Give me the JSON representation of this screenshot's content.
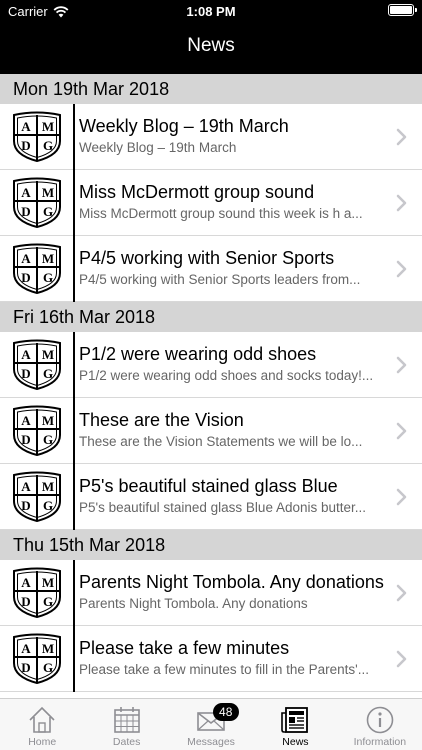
{
  "status": {
    "carrier": "Carrier",
    "time": "1:08 PM",
    "battery_level": 1.0
  },
  "header": {
    "title": "News"
  },
  "icons": {
    "crest": "amdg-crest-icon",
    "chevron": "chevron-right-icon"
  },
  "crest_letters": [
    "A",
    "M",
    "D",
    "G"
  ],
  "sections": [
    {
      "date": "Mon 19th Mar 2018",
      "items": [
        {
          "title": "Weekly Blog – 19th March",
          "subtitle": "Weekly Blog – 19th March"
        },
        {
          "title": "Miss McDermott  group sound",
          "subtitle": "Miss McDermott  group sound this week is h a..."
        },
        {
          "title": "P4/5 working with Senior Sports",
          "subtitle": "P4/5 working with Senior Sports leaders from..."
        }
      ]
    },
    {
      "date": "Fri 16th Mar 2018",
      "items": [
        {
          "title": "P1/2 were wearing odd shoes",
          "subtitle": "P1/2 were wearing odd shoes and socks today!..."
        },
        {
          "title": "These are the  Vision",
          "subtitle": "These are the  Vision Statements we will be lo..."
        },
        {
          "title": "P5's beautiful stained glass Blue",
          "subtitle": "P5's beautiful stained glass Blue Adonis butter..."
        }
      ]
    },
    {
      "date": "Thu 15th Mar 2018",
      "items": [
        {
          "title": "Parents Night Tombola. Any donations",
          "subtitle": "Parents Night Tombola. Any donations"
        },
        {
          "title": "Please take a few minutes",
          "subtitle": "Please take a few minutes to fill in the Parents'..."
        }
      ]
    }
  ],
  "tabs": [
    {
      "label": "Home",
      "icon": "home-icon",
      "active": false
    },
    {
      "label": "Dates",
      "icon": "calendar-icon",
      "active": false
    },
    {
      "label": "Messages",
      "icon": "envelope-icon",
      "active": false,
      "badge": "48"
    },
    {
      "label": "News",
      "icon": "newspaper-icon",
      "active": true
    },
    {
      "label": "Information",
      "icon": "info-icon",
      "active": false
    }
  ]
}
